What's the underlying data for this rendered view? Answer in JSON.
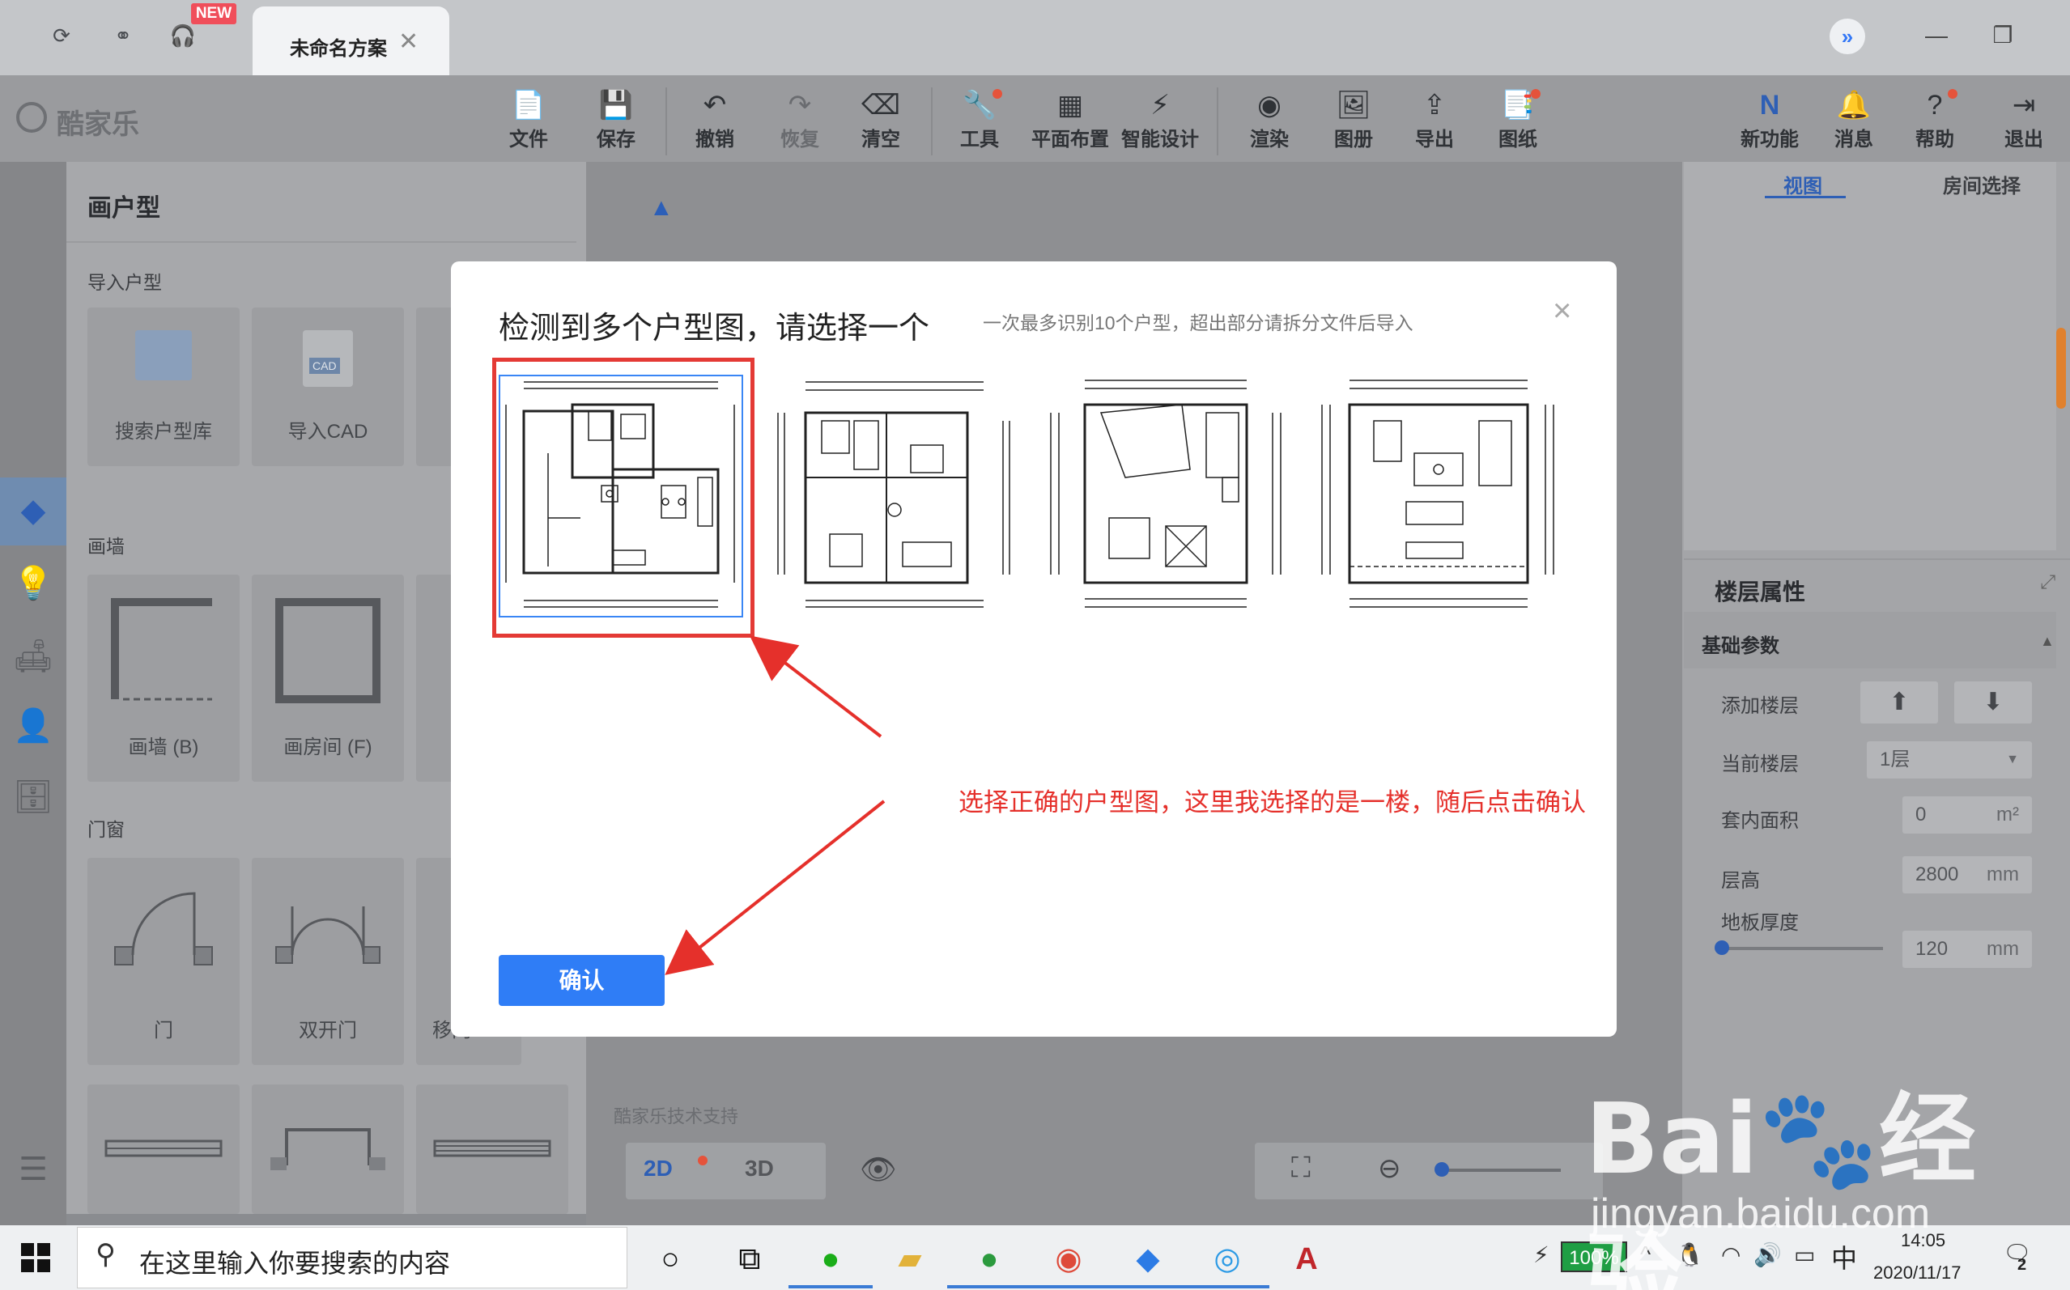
{
  "titlebar": {
    "new_badge": "NEW",
    "tab_title": "未命名方案",
    "tab_close": "✕",
    "expand_glyph": "»",
    "minimize": "—",
    "restore": "❐"
  },
  "brand": {
    "logo_text": "酷家乐"
  },
  "toolbar": {
    "items": [
      {
        "label": "文件",
        "icon": "file-icon"
      },
      {
        "label": "保存",
        "icon": "save-icon"
      },
      {
        "label": "撤销",
        "icon": "undo-icon"
      },
      {
        "label": "恢复",
        "icon": "redo-icon"
      },
      {
        "label": "清空",
        "icon": "eraser-icon"
      },
      {
        "label": "工具",
        "icon": "wrench-icon"
      },
      {
        "label": "平面布置",
        "icon": "layout-icon"
      },
      {
        "label": "智能设计",
        "icon": "lightning-icon"
      },
      {
        "label": "渲染",
        "icon": "camera-icon"
      },
      {
        "label": "图册",
        "icon": "image-icon"
      },
      {
        "label": "导出",
        "icon": "export-icon"
      },
      {
        "label": "图纸",
        "icon": "drawing-icon"
      },
      {
        "label": "新功能",
        "icon": "new-feature-icon"
      },
      {
        "label": "消息",
        "icon": "bell-icon"
      },
      {
        "label": "帮助",
        "icon": "help-icon"
      },
      {
        "label": "退出",
        "icon": "exit-icon"
      }
    ]
  },
  "left_panel": {
    "title": "画户型",
    "import_section": "导入户型",
    "import_cards": [
      "搜索户型库",
      "导入CAD"
    ],
    "cad_badge": "CAD",
    "wall_section": "画墙",
    "wall_cards": [
      "画墙 (B)",
      "画房间 (F)"
    ],
    "door_section": "门窗",
    "door_cards": [
      "门",
      "双开门"
    ],
    "partial_label": "移门"
  },
  "canvas": {
    "support_text": "酷家乐技术支持",
    "view_2d": "2D",
    "view_3d": "3D"
  },
  "right_panel": {
    "tab_view": "视图",
    "tab_room": "房间选择",
    "floor_title": "楼层属性",
    "basic_params": "基础参数",
    "add_floor": "添加楼层",
    "current_floor_label": "当前楼层",
    "current_floor_value": "1层",
    "inner_area_label": "套内面积",
    "inner_area_value": "0",
    "inner_area_unit": "m²",
    "height_label": "层高",
    "height_value": "2800",
    "height_unit": "mm",
    "thickness_label": "地板厚度",
    "thickness_value": "120",
    "thickness_unit": "mm"
  },
  "modal": {
    "title": "检测到多个户型图，请选择一个",
    "subtitle": "一次最多识别10个户型，超出部分请拆分文件后导入",
    "close": "×",
    "plans_count": 4,
    "selected_index": 0,
    "confirm_label": "确认"
  },
  "annotation": {
    "text": "选择正确的户型图，这里我选择的是一楼，随后点击确认",
    "color": "#e5302b"
  },
  "taskbar": {
    "search_placeholder": "在这里输入你要搜索的内容",
    "battery": "100%",
    "ime": "中",
    "time": "14:05",
    "date": "2020/11/17",
    "notif_count": "2"
  },
  "watermark": {
    "logo": "Bai经验",
    "url": "jingyan.baidu.com"
  },
  "colors": {
    "accent": "#2f7df6",
    "selection_red": "#e43a35",
    "overlay": "#8e8f92"
  }
}
